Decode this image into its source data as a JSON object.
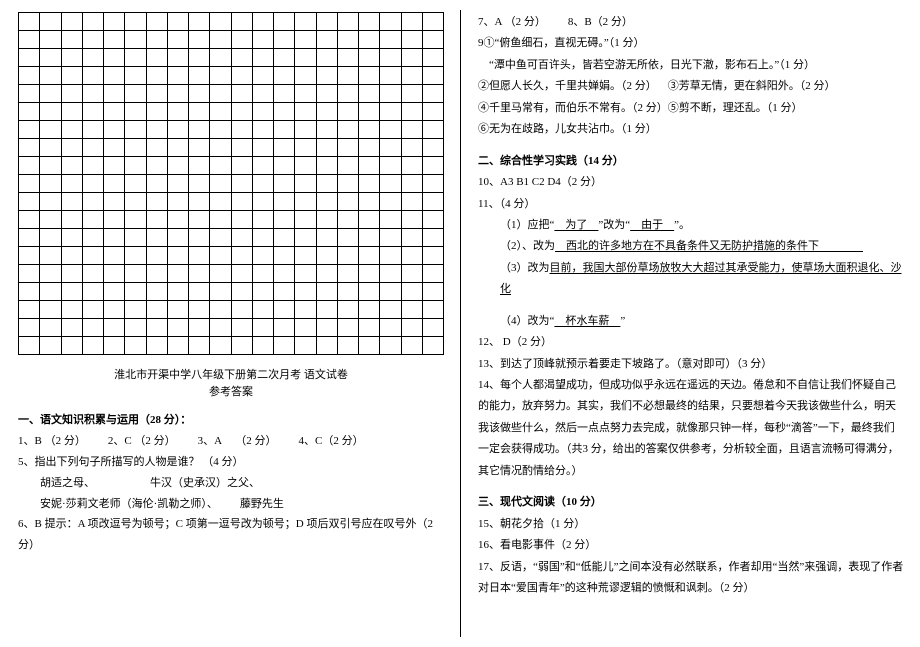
{
  "left": {
    "grid": {
      "rows": 19,
      "cols": 20
    },
    "title_line1": "淮北市开渠中学八年级下册第二次月考 语文试卷",
    "title_line2": "参考答案",
    "section1_head": "一、语文知识积累与运用（28 分）：",
    "q1_4": "1、B （2 分）  2、C （2 分）  3、A  （2 分）  4、C（2 分）",
    "q5_head": "5、指出下列句子所描写的人物是谁？ （4 分）",
    "q5_a": "胡适之母、     牛汉（史承汉）之父、",
    "q5_b": "安妮·莎莉文老师（海伦·凯勒之师）、  藤野先生",
    "q6": "6、B 提示：A 项改逗号为顿号；C 项第一逗号改为顿号；D 项后双引号应在叹号外（2 分）"
  },
  "right": {
    "q7_8": "7、A （2 分）  8、B（2 分）",
    "q9_1": "9①“俯鱼细石，直视无碍。”（1 分）",
    "q9_1b": " “潭中鱼可百许头，皆若空游无所依，日光下澈，影布石上。”（1 分）",
    "q9_2": "②但愿人长久，千里共婵娟。（2 分） ③芳草无情，更在斜阳外。（2 分）",
    "q9_4": "④千里马常有，而伯乐不常有。（2 分）⑤剪不断，理还乱。（1 分）",
    "q9_6": "⑥无为在歧路，儿女共沾巾。（1 分）",
    "section2_head": "二、综合性学习实践（14 分）",
    "q10": "10、A3  B1  C2  D4（2 分）",
    "q11_head": "11、（4 分）",
    "q11_1_pre": "（1）应把“",
    "q11_1_u1": " 为了 ",
    "q11_1_mid": "”改为“",
    "q11_1_u2": " 由于 ",
    "q11_1_post": "”。",
    "q11_2_pre": "（2）、改为",
    "q11_2_u": " 西北的许多地方在不具备条件又无防护措施的条件下    ",
    "q11_3_pre": "（3）改为",
    "q11_3_u": "目前，我国大部份草场放牧大大超过其承受能力，使草场大面积退化、沙化",
    "q11_4_pre": "（4）改为“",
    "q11_4_u": " 杯水车薪 ",
    "q11_4_post": "”",
    "q12": "12、 D（2 分）",
    "q13": "13、到达了顶峰就预示着要走下坡路了。（意对即可）（3 分）",
    "q14": "14、每个人都渴望成功，但成功似乎永远在遥远的天边。倦怠和不自信让我们怀疑自己的能力，放弃努力。其实，我们不必想最终的结果，只要想着今天我该做些什么，明天我该做些什么，然后一点点努力去完成，就像那只钟一样，每秒“滴答”一下，最终我们一定会获得成功。（共3 分，给出的答案仅供参考，分析较全面，且语言流畅可得满分，其它情况酌情给分。）",
    "section3_head": "三、现代文阅读（10 分）",
    "q15": "15、朝花夕拾（1 分）",
    "q16": "16、看电影事件（2 分）",
    "q17": "17、反语，“弱国”和“低能儿”之间本没有必然联系，作者却用“当然”来强调，表现了作者对日本“爱国青年”的这种荒谬逻辑的愤慨和讽刺。（2 分）"
  }
}
